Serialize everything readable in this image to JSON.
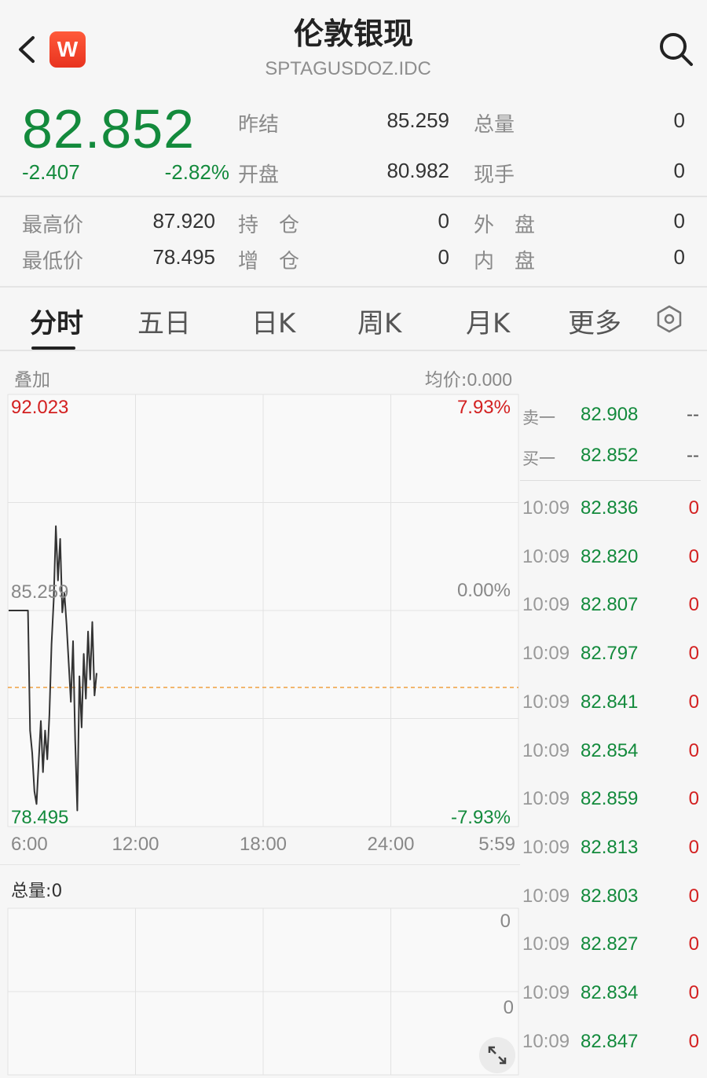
{
  "header": {
    "title": "伦敦银现",
    "code": "SPTAGUSDOZ.IDC",
    "app_badge": "W"
  },
  "quote": {
    "last": "82.852",
    "change": "-2.407",
    "change_pct": "-2.82%",
    "prev_close_label": "昨结",
    "prev_close": "85.259",
    "volume_label": "总量",
    "volume": "0",
    "open_label": "开盘",
    "open": "80.982",
    "current_hand_label": "现手",
    "current_hand": "0",
    "high_label": "最高价",
    "high": "87.920",
    "position_label": "持　仓",
    "position": "0",
    "outer_label": "外　盘",
    "outer": "0",
    "low_label": "最低价",
    "low": "78.495",
    "increase_label": "增　仓",
    "increase": "0",
    "inner_label": "内　盘",
    "inner": "0"
  },
  "tabs": [
    {
      "label": "分时",
      "active": true
    },
    {
      "label": "五日",
      "active": false
    },
    {
      "label": "日K",
      "active": false
    },
    {
      "label": "周K",
      "active": false
    },
    {
      "label": "月K",
      "active": false
    },
    {
      "label": "更多",
      "active": false
    }
  ],
  "chart": {
    "overlay_label": "叠加",
    "avg_price_label": "均价:",
    "avg_price": "0.000",
    "volume_label": "总量:0"
  },
  "chart_data": {
    "type": "line",
    "y_max_label": "92.023",
    "y_mid_label": "85.259",
    "y_min_label": "78.495",
    "pct_max_label": "7.93%",
    "pct_mid_label": "0.00%",
    "pct_min_label": "-7.93%",
    "ylim": [
      78.495,
      92.023
    ],
    "x_tick_labels": [
      "6:00",
      "12:00",
      "18:00",
      "24:00",
      "5:59"
    ],
    "reference_line": 82.852,
    "series": [
      {
        "values": [
          85.26,
          85.26,
          85.26,
          85.26,
          85.26,
          85.26,
          85.26,
          85.26,
          85.26,
          85.26,
          81.5,
          80.8,
          79.6,
          79.2,
          80.5,
          81.8,
          80.2,
          81.5,
          80.6,
          82.0,
          84.2,
          85.6,
          87.9,
          86.2,
          87.5,
          85.2,
          85.8,
          84.8,
          83.6,
          82.4,
          84.3,
          81.2,
          79.0,
          83.2,
          81.6,
          83.9,
          82.5,
          84.6,
          83.1,
          84.9,
          82.6,
          83.3
        ],
        "color": "#333333"
      }
    ],
    "volume_axis_labels": [
      "0",
      "0"
    ]
  },
  "order_book": {
    "ask_label": "卖一",
    "ask_price": "82.908",
    "ask_vol": "--",
    "bid_label": "买一",
    "bid_price": "82.852",
    "bid_vol": "--",
    "ticks": [
      {
        "time": "10:09",
        "price": "82.836",
        "vol": "0"
      },
      {
        "time": "10:09",
        "price": "82.820",
        "vol": "0"
      },
      {
        "time": "10:09",
        "price": "82.807",
        "vol": "0"
      },
      {
        "time": "10:09",
        "price": "82.797",
        "vol": "0"
      },
      {
        "time": "10:09",
        "price": "82.841",
        "vol": "0"
      },
      {
        "time": "10:09",
        "price": "82.854",
        "vol": "0"
      },
      {
        "time": "10:09",
        "price": "82.859",
        "vol": "0"
      },
      {
        "time": "10:09",
        "price": "82.813",
        "vol": "0"
      },
      {
        "time": "10:09",
        "price": "82.803",
        "vol": "0"
      },
      {
        "time": "10:09",
        "price": "82.827",
        "vol": "0"
      },
      {
        "time": "10:09",
        "price": "82.834",
        "vol": "0"
      },
      {
        "time": "10:09",
        "price": "82.847",
        "vol": "0"
      }
    ]
  },
  "colors": {
    "down": "#138a3c",
    "up": "#d32020",
    "ref_line": "#f0a040"
  },
  "icons": [
    "back-icon",
    "search-icon",
    "settings-hexagon-icon",
    "expand-icon"
  ]
}
